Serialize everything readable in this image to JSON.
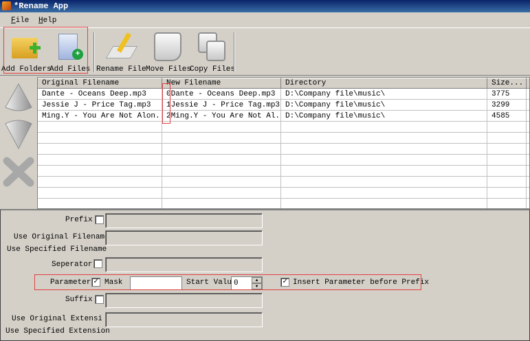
{
  "window": {
    "title": "*Rename App"
  },
  "menu": [
    {
      "label": "File",
      "key": "F",
      "rest": "ile"
    },
    {
      "label": "Help",
      "key": "H",
      "rest": "elp"
    }
  ],
  "toolbar": {
    "add_folders": "Add Folders",
    "add_files": "Add Files",
    "rename_files": "Rename Files",
    "move_files": "Move Files",
    "copy_files": "Copy Files"
  },
  "side": {
    "move_up": "move-up",
    "move_down": "move-down",
    "remove": "remove"
  },
  "table": {
    "columns": [
      "Original Filename",
      "New Filename",
      "Directory",
      "Size..."
    ],
    "rows": [
      [
        "Dante - Oceans Deep.mp3",
        "0Dante - Oceans Deep.mp3",
        "D:\\Company file\\music\\",
        "3775"
      ],
      [
        "Jessie J - Price Tag.mp3",
        "1Jessie J - Price Tag.mp3",
        "D:\\Company file\\music\\",
        "3299"
      ],
      [
        "Ming.Y - You Are Not Alon...",
        "2Ming.Y - You Are Not Al...",
        "D:\\Company file\\music\\",
        "4585"
      ]
    ]
  },
  "form": {
    "prefix": "Prefix",
    "use_original_filename": "Use Original Filename",
    "use_specified_filename": "Use Specified Filename",
    "separator": "Seperator",
    "parameter": "Parameter",
    "mask": "Mask",
    "mask_value": "",
    "start_value": "Start Value",
    "start_value_value": "0",
    "insert_before_prefix": "Insert Parameter before Prefix",
    "suffix": "Suffix",
    "use_original_extension": "Use Original Extension",
    "use_specified_extension": "Use Specified Extension",
    "checks": {
      "prefix": false,
      "separator": false,
      "parameter": true,
      "insert_before_prefix": true,
      "suffix": false
    }
  },
  "colors": {
    "highlight": "#e04040",
    "titlebar": "#0a246a"
  }
}
